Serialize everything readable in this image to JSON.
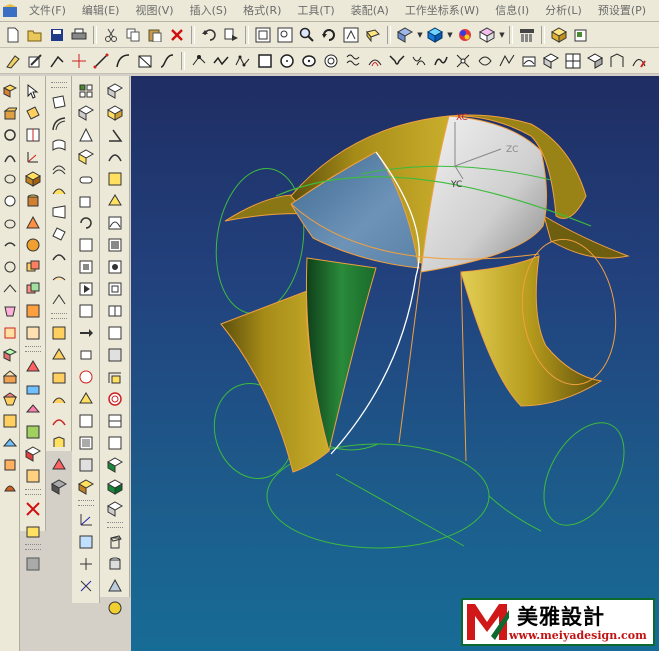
{
  "menu": {
    "items": [
      {
        "label": "文件(F)"
      },
      {
        "label": "编辑(E)"
      },
      {
        "label": "视图(V)"
      },
      {
        "label": "插入(S)"
      },
      {
        "label": "格式(R)"
      },
      {
        "label": "工具(T)"
      },
      {
        "label": "装配(A)"
      },
      {
        "label": "工作坐标系(W)"
      },
      {
        "label": "信息(I)"
      },
      {
        "label": "分析(L)"
      },
      {
        "label": "预设置(P)"
      }
    ]
  },
  "viewport": {
    "wcs_labels": {
      "x": "XC",
      "y": "YC",
      "z": "ZC"
    },
    "colors": {
      "gold": "#b59a1c",
      "silver": "#c8c8c8",
      "blue": "#5a7fa4",
      "green": "#2a8a3a",
      "edge": "#f0a040",
      "wire": "#3dbb3d"
    }
  },
  "watermark": {
    "title": "美雅設計",
    "url": "www.meiyadesign.com"
  }
}
